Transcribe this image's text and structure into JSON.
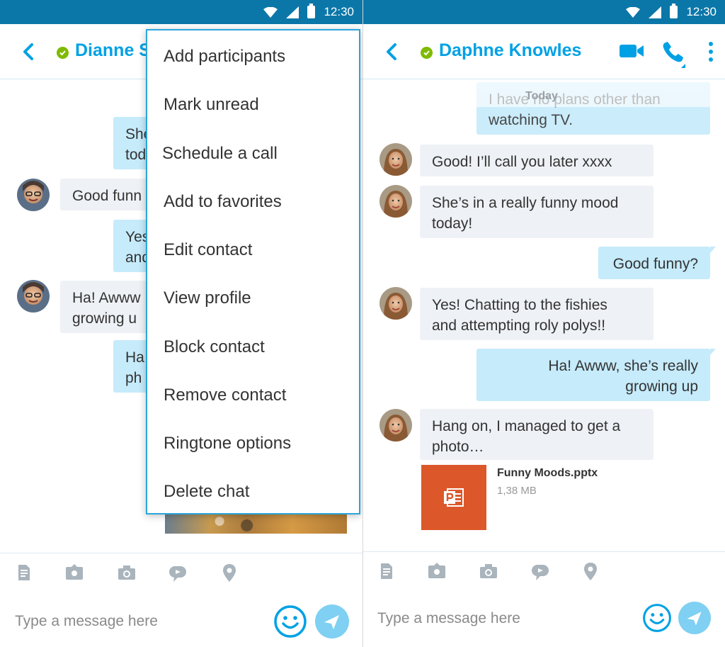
{
  "status_bar": {
    "time": "12:30"
  },
  "left": {
    "contact_name": "Dianne S",
    "messages": [
      {
        "text": "She\ntod"
      },
      {
        "text": "Good funn"
      },
      {
        "text": "Yes\nand"
      },
      {
        "text": "Ha! Awww\ngrowing u"
      },
      {
        "text": "Ha\nph"
      }
    ],
    "menu": {
      "items": [
        "Add participants",
        "Mark unread",
        "Schedule a call",
        "Add to favorites",
        "Edit contact",
        "View profile",
        "Block contact",
        "Remove contact",
        "Ringtone options",
        "Delete chat"
      ]
    },
    "composer": {
      "placeholder": "Type a message here"
    }
  },
  "right": {
    "contact_name": "Daphne Knowles",
    "today_label": "Today",
    "messages": [
      {
        "text": "I have no plans other than\nwatching TV."
      },
      {
        "text": "Good! I’ll call you later xxxx"
      },
      {
        "text": "She’s in a really funny mood\ntoday!"
      },
      {
        "text": "Good funny?"
      },
      {
        "text": "Yes! Chatting to the fishies\nand attempting roly polys!!"
      },
      {
        "text": "Ha! Awww, she’s really\ngrowing up"
      },
      {
        "text": "Hang on, I managed to get a\nphoto…"
      }
    ],
    "file": {
      "name": "Funny Moods.pptx",
      "size": "1,38 MB",
      "icon": "powerpoint-icon"
    },
    "composer": {
      "placeholder": "Type a message here"
    }
  },
  "toolbar_icons": [
    "file-icon",
    "media-message-icon",
    "camera-icon",
    "video-message-icon",
    "location-icon"
  ],
  "colors": {
    "status_bar": "#0b77a8",
    "accent": "#00a1e4",
    "presence": "#7fba00",
    "incoming_bubble": "#eef1f5",
    "outgoing_bubble": "#c6ebfb",
    "file_thumb": "#dc582a",
    "menu_border": "#2aa6dc"
  }
}
